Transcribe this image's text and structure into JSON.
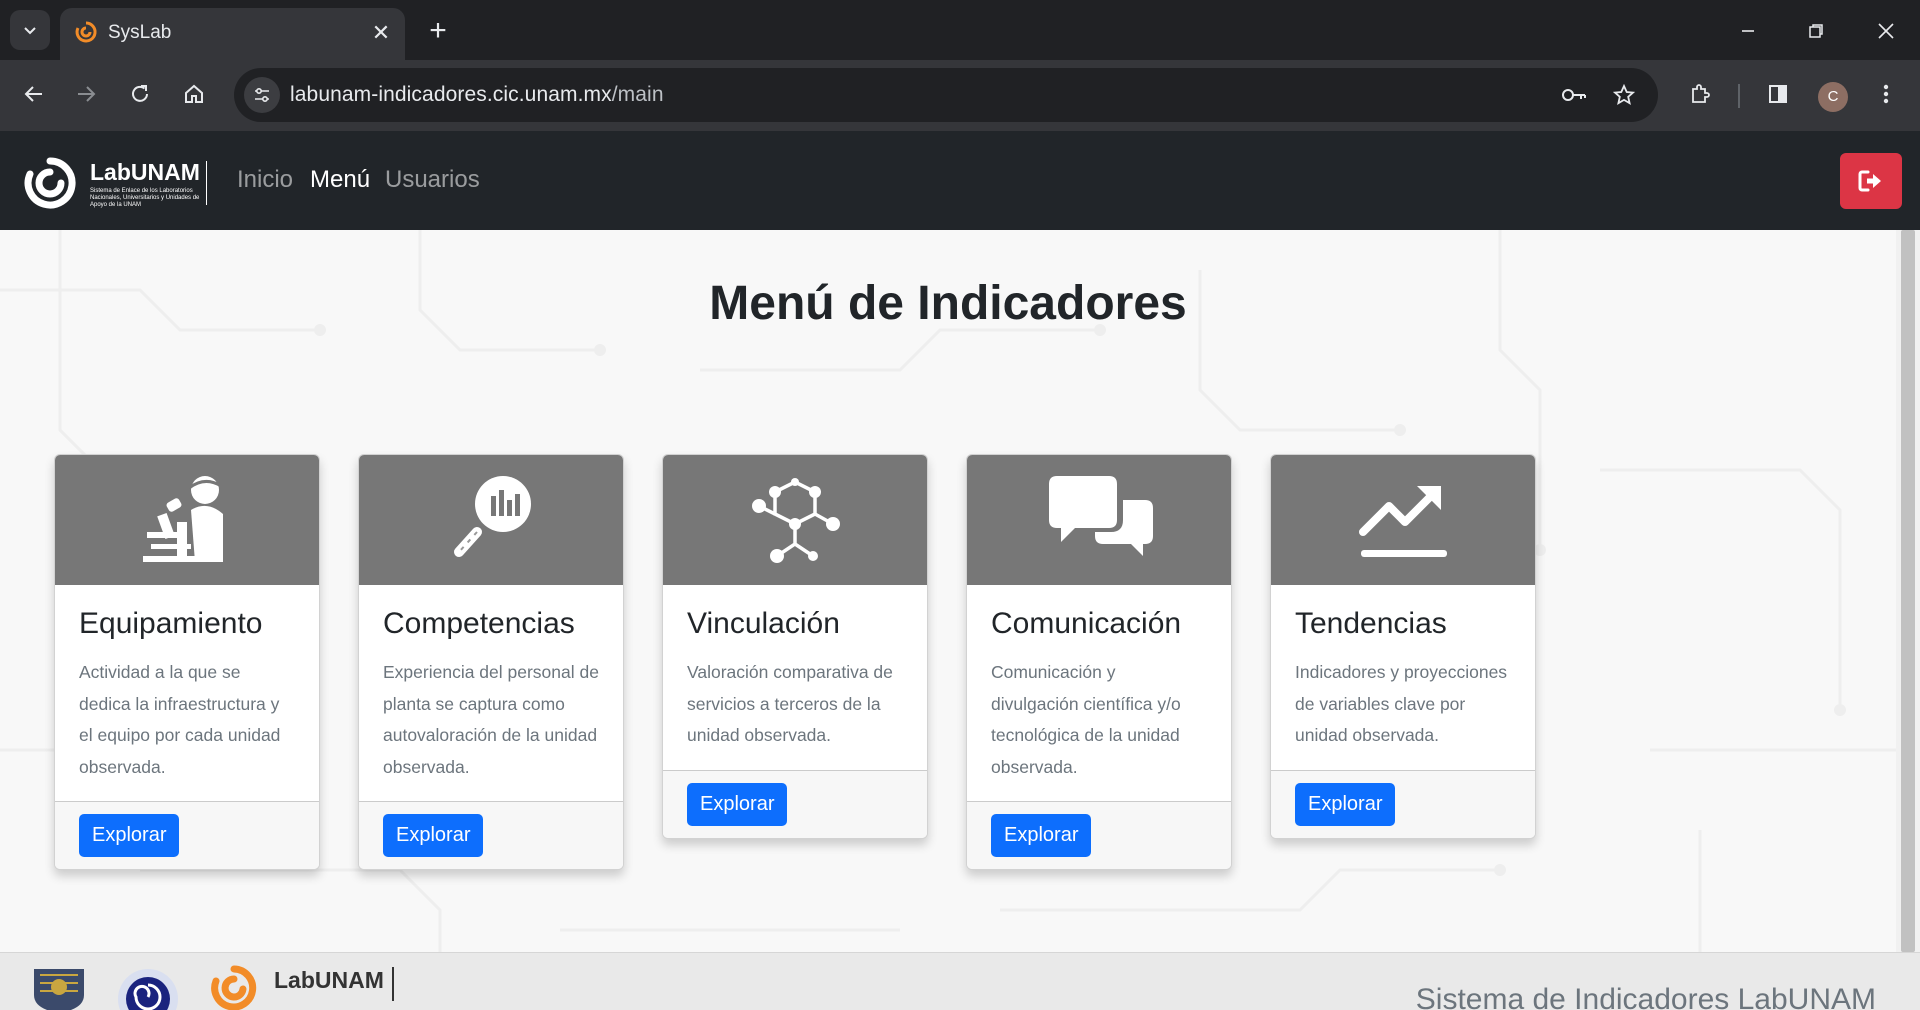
{
  "browser": {
    "tab_title": "SysLab",
    "url_host": "labunam-indicadores.cic.unam.mx",
    "url_path": "/main",
    "profile_initial": "C"
  },
  "navbar": {
    "logo_text": "LabUNAM",
    "logo_subtitle": "Sistema de Enlace de los Laboratorios Nacionales, Universitarios y Unidades de Apoyo de la UNAM",
    "links": [
      {
        "label": "Inicio",
        "active": false
      },
      {
        "label": "Menú",
        "active": true
      },
      {
        "label": "Usuarios",
        "active": false
      }
    ],
    "logout_icon": "sign-out-icon",
    "logout_color": "#dc3545"
  },
  "main": {
    "title": "Menú de Indicadores",
    "cards": [
      {
        "icon": "scientist-microscope-icon",
        "title": "Equipamiento",
        "text": "Actividad a la que se dedica la infraestructura y el equipo por cada unidad observada.",
        "button": "Explorar"
      },
      {
        "icon": "magnifier-chart-icon",
        "title": "Competencias",
        "text": "Experiencia del personal de planta se captura como autovaloración de la unidad observada.",
        "button": "Explorar"
      },
      {
        "icon": "network-hexagon-icon",
        "title": "Vinculación",
        "text": "Valoración comparativa de servicios a terceros de la unidad observada.",
        "button": "Explorar"
      },
      {
        "icon": "chat-bubbles-icon",
        "title": "Comunicación",
        "text": "Comunicación y divulgación científica y/o tecnológica de la unidad observada.",
        "button": "Explorar"
      },
      {
        "icon": "trend-up-icon",
        "title": "Tendencias",
        "text": "Indicadores y proyecciones de variables clave por unidad observada.",
        "button": "Explorar"
      }
    ]
  },
  "footer": {
    "logo_text": "LabUNAM",
    "text": "Sistema de Indicadores LabUNAM"
  },
  "colors": {
    "primary": "#0d6efd",
    "navbar_bg": "#212529",
    "card_header_bg": "#777777",
    "brand_orange": "#f28c28"
  }
}
